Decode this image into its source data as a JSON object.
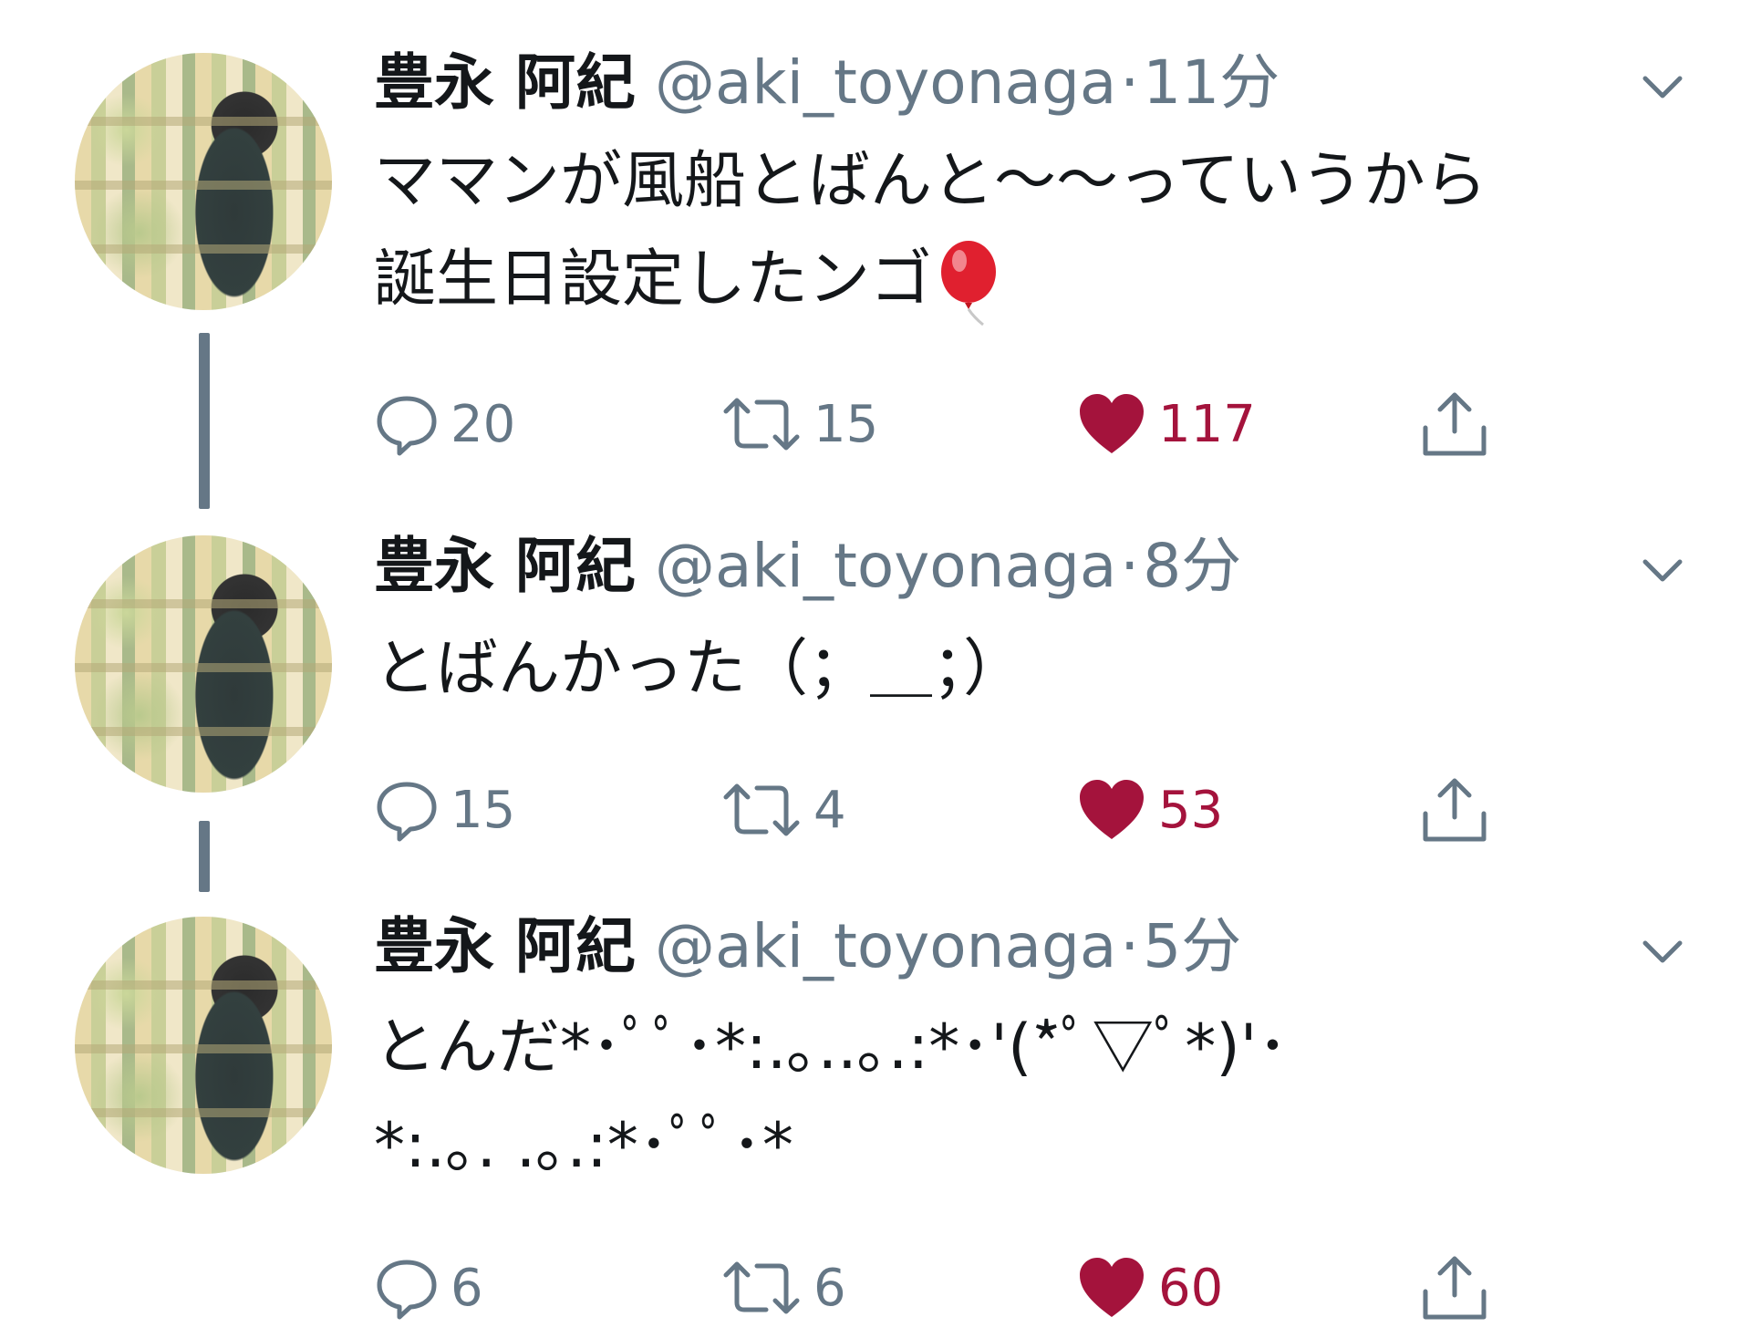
{
  "colors": {
    "name": "#14171a",
    "meta": "#657786",
    "like": "#a4133c",
    "thread_line": "#657786"
  },
  "tweets": [
    {
      "name": "豊永 阿紀",
      "handle": "@aki_toyonaga",
      "separator": "·",
      "time": "11分",
      "lines": [
        "ママンが風船とばんと〜〜っていうから",
        "誕生日設定したンゴ"
      ],
      "emoji": "balloon-emoji",
      "replies": "20",
      "retweets": "15",
      "likes": "117",
      "icons": [
        "reply-icon",
        "retweet-icon",
        "heart-icon",
        "share-icon",
        "chevron-down-icon"
      ]
    },
    {
      "name": "豊永 阿紀",
      "handle": "@aki_toyonaga",
      "separator": "·",
      "time": "8分",
      "lines": [
        "とばんかった（；＿；）"
      ],
      "replies": "15",
      "retweets": "4",
      "likes": "53"
    },
    {
      "name": "豊永 阿紀",
      "handle": "@aki_toyonaga",
      "separator": "·",
      "time": "5分",
      "lines": [
        "とんだ*･ﾟﾟ･*:.｡..｡.:*･'(*ﾟ▽ﾟ*)'･",
        "*:.｡. .｡.:*･ﾟﾟ･*"
      ],
      "replies": "6",
      "retweets": "6",
      "likes": "60"
    }
  ]
}
